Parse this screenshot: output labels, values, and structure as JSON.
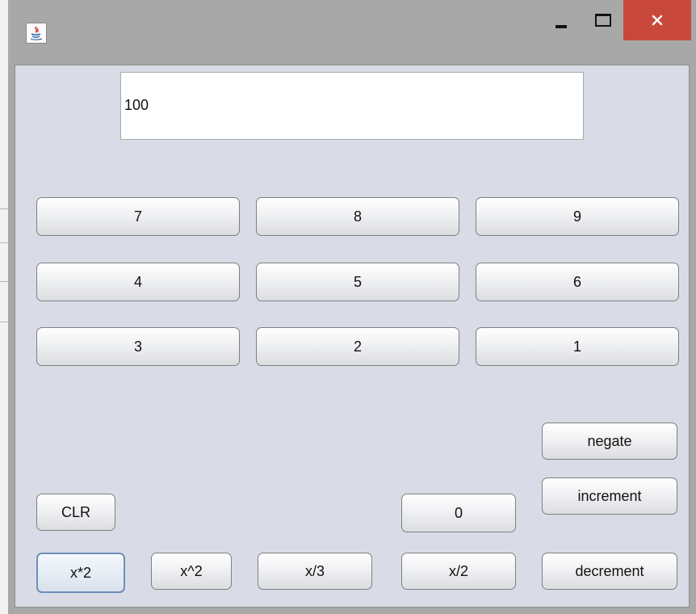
{
  "display": {
    "value": "100"
  },
  "keypad": {
    "row1": [
      "7",
      "8",
      "9"
    ],
    "row2": [
      "4",
      "5",
      "6"
    ],
    "row3": [
      "3",
      "2",
      "1"
    ]
  },
  "controls": {
    "negate": "negate",
    "increment": "increment",
    "decrement": "decrement",
    "clear": "CLR",
    "zero": "0",
    "times_two": "x*2",
    "square": "x^2",
    "div_three": "x/3",
    "div_two": "x/2"
  },
  "colors": {
    "close_button": "#c8483b",
    "panel_background": "#d9dce6",
    "title_bar": "#a8a8a8",
    "focus_border": "#6d8fb8"
  },
  "icons": {
    "app": "java-icon",
    "minimize": "minimize-icon",
    "maximize": "maximize-icon",
    "close": "close-icon"
  }
}
